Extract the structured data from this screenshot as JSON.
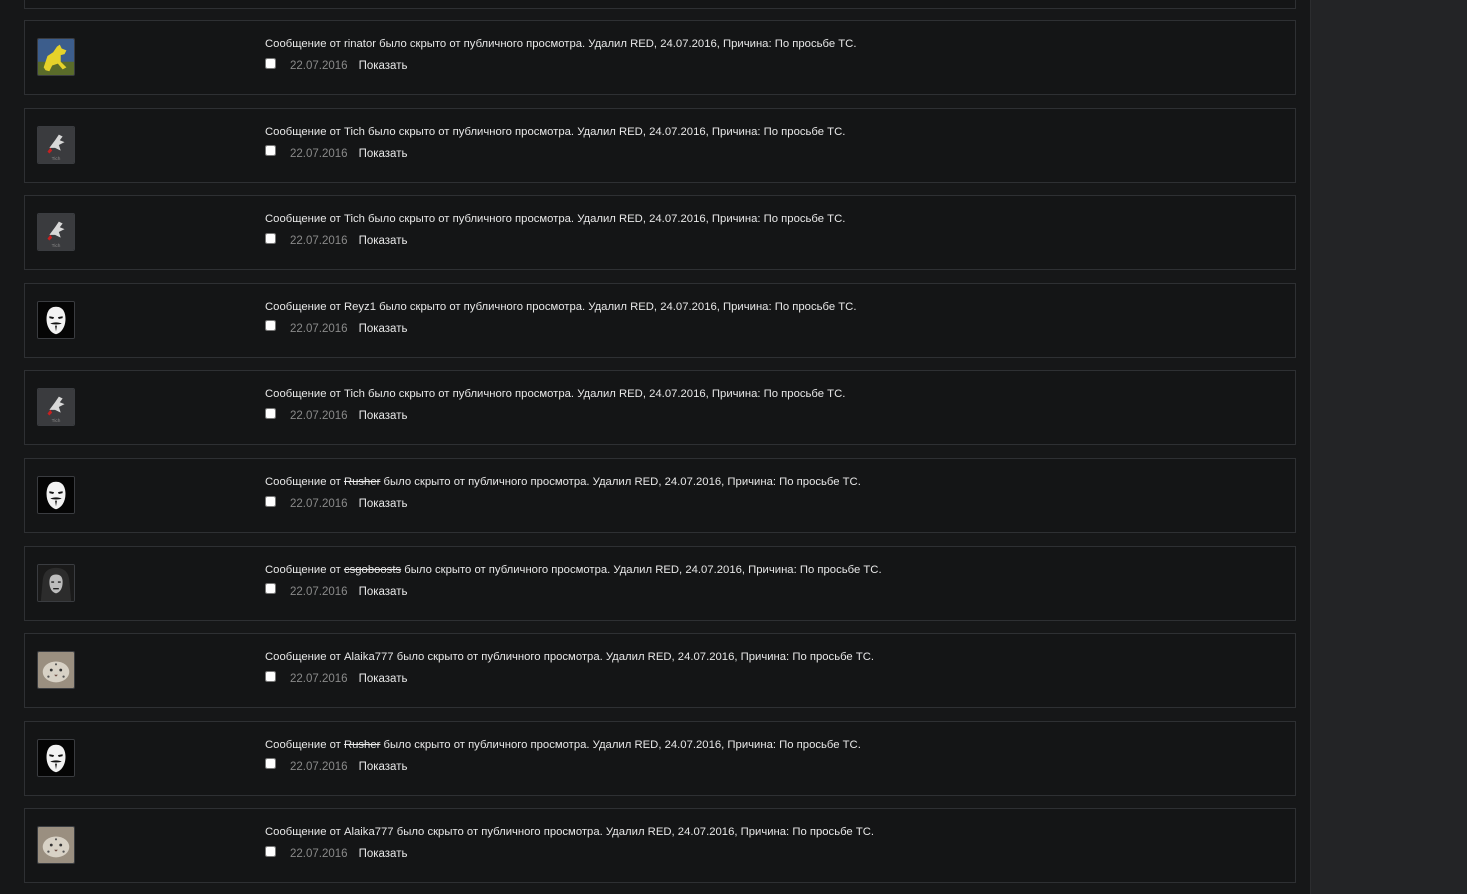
{
  "posts": [
    {
      "prefix": "Сообщение от ",
      "author": "rinator",
      "strike": false,
      "suffix": " было скрыто от публичного просмотра. Удалил RED, 24.07.2016, Причина: По просьбе ТС.",
      "date": "22.07.2016",
      "action": "Показать",
      "avatar": "dog-icon"
    },
    {
      "prefix": "Сообщение от ",
      "author": "Tich",
      "strike": false,
      "suffix": " было скрыто от публичного просмотра. Удалил RED, 24.07.2016, Причина: По просьбе ТС.",
      "date": "22.07.2016",
      "action": "Показать",
      "avatar": "dragon-icon"
    },
    {
      "prefix": "Сообщение от ",
      "author": "Tich",
      "strike": false,
      "suffix": " было скрыто от публичного просмотра. Удалил RED, 24.07.2016, Причина: По просьбе ТС.",
      "date": "22.07.2016",
      "action": "Показать",
      "avatar": "dragon-icon"
    },
    {
      "prefix": "Сообщение от ",
      "author": "Reyz1",
      "strike": false,
      "suffix": " было скрыто от публичного просмотра. Удалил RED, 24.07.2016, Причина: По просьбе ТС.",
      "date": "22.07.2016",
      "action": "Показать",
      "avatar": "mask-icon"
    },
    {
      "prefix": "Сообщение от ",
      "author": "Tich",
      "strike": false,
      "suffix": " было скрыто от публичного просмотра. Удалил RED, 24.07.2016, Причина: По просьбе ТС.",
      "date": "22.07.2016",
      "action": "Показать",
      "avatar": "dragon-icon"
    },
    {
      "prefix": "Сообщение от ",
      "author": "Rusher",
      "strike": true,
      "suffix": " было скрыто от публичного просмотра. Удалил RED, 24.07.2016, Причина: По просьбе ТС.",
      "date": "22.07.2016",
      "action": "Показать",
      "avatar": "mask-icon"
    },
    {
      "prefix": "Сообщение от ",
      "author": "csgoboosts",
      "strike": true,
      "suffix": " было скрыто от публичного просмотра. Удалил RED, 24.07.2016, Причина: По просьбе ТС.",
      "date": "22.07.2016",
      "action": "Показать",
      "avatar": "hooded-figure-icon"
    },
    {
      "prefix": "Сообщение от ",
      "author": "Alaika777",
      "strike": false,
      "suffix": " было скрыто от публичного просмотра. Удалил RED, 24.07.2016, Причина: По просьбе ТС.",
      "date": "22.07.2016",
      "action": "Показать",
      "avatar": "snow-leopard-icon"
    },
    {
      "prefix": "Сообщение от ",
      "author": "Rusher",
      "strike": true,
      "suffix": " было скрыто от публичного просмотра. Удалил RED, 24.07.2016, Причина: По просьбе ТС.",
      "date": "22.07.2016",
      "action": "Показать",
      "avatar": "mask-icon"
    },
    {
      "prefix": "Сообщение от ",
      "author": "Alaika777",
      "strike": false,
      "suffix": " было скрыто от публичного просмотра. Удалил RED, 24.07.2016, Причина: По просьбе ТС.",
      "date": "22.07.2016",
      "action": "Показать",
      "avatar": "snow-leopard-icon"
    }
  ],
  "colors": {
    "page_bg": "#161718",
    "sidebar_bg": "#232426",
    "row_border": "#2e3033",
    "text": "#e8e8e8",
    "date": "#8a8a8a"
  }
}
